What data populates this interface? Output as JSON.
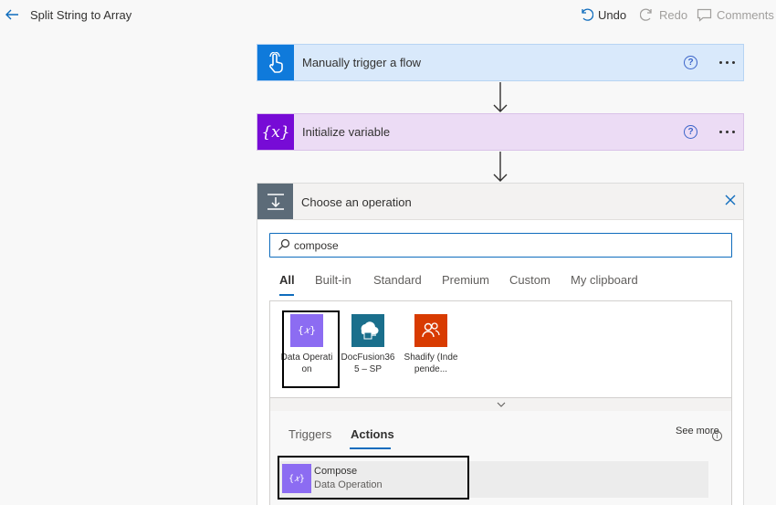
{
  "header": {
    "title": "Split String to Array",
    "undo_label": "Undo",
    "redo_label": "Redo",
    "comments_label": "Comments"
  },
  "steps": [
    {
      "label": "Manually trigger a flow",
      "icon": "hand-touch-icon",
      "color": "#0f7adb"
    },
    {
      "label": "Initialize variable",
      "icon": "variable-icon",
      "icon_text": "{x}",
      "color": "#770bd6"
    }
  ],
  "chooser": {
    "title": "Choose an operation",
    "search_value": "compose",
    "tabs": [
      "All",
      "Built-in",
      "Standard",
      "Premium",
      "Custom",
      "My clipboard"
    ],
    "active_tab": "All",
    "connectors": [
      {
        "label": "Data Operation",
        "icon": "data-operation-icon",
        "color": "#8c6cf2"
      },
      {
        "label": "DocFusion365 – SP",
        "icon": "docfusion-icon",
        "color": "#1a6f8c"
      },
      {
        "label": "Shadify (Independe...",
        "icon": "shadify-icon",
        "color": "#d83b01"
      }
    ],
    "subtabs": [
      "Triggers",
      "Actions"
    ],
    "active_subtab": "Actions",
    "see_more": "See more",
    "actions": [
      {
        "name": "Compose",
        "connector": "Data Operation"
      }
    ]
  },
  "colors": {
    "accent": "#0f6cbd",
    "trigger_bg": "#d9e9fb",
    "variable_bg": "#ecdcf5"
  }
}
